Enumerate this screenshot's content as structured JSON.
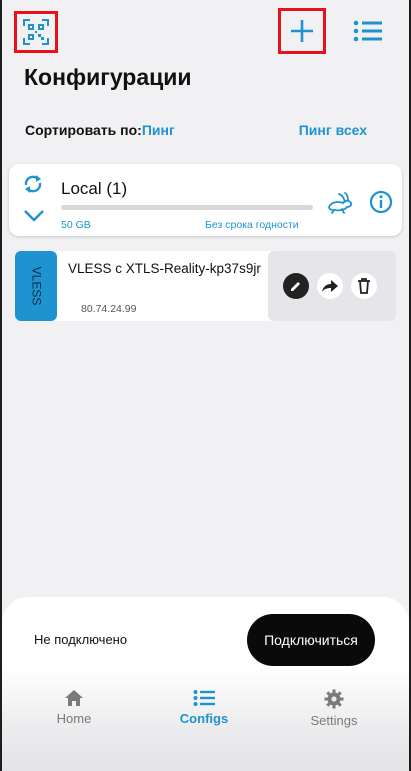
{
  "header": {
    "title": "Конфигурации",
    "qr_icon": "qr-code-scan-icon",
    "add_icon": "plus-icon",
    "menu_icon": "list-icon"
  },
  "sort": {
    "label": "Сортировать по:",
    "value": "Пинг",
    "ping_all": "Пинг всех"
  },
  "group": {
    "name": "Local (1)",
    "usage_total": "50 GB",
    "usage_fraction": 0.0,
    "expiry": "Без срока годности"
  },
  "config": {
    "protocol": "VLESS",
    "name": "VLESS с XTLS-Reality-kp37s9jr",
    "address": "80.74.24.99"
  },
  "status": {
    "text": "Не подключено",
    "connect_label": "Подключиться"
  },
  "nav": {
    "items": [
      {
        "label": "Home",
        "icon": "home-icon",
        "active": false
      },
      {
        "label": "Configs",
        "icon": "list-icon",
        "active": true
      },
      {
        "label": "Settings",
        "icon": "gear-icon",
        "active": false
      }
    ]
  },
  "colors": {
    "accent": "#1e93cf",
    "highlight_border": "#e8121b",
    "background": "#f1f1f4"
  }
}
